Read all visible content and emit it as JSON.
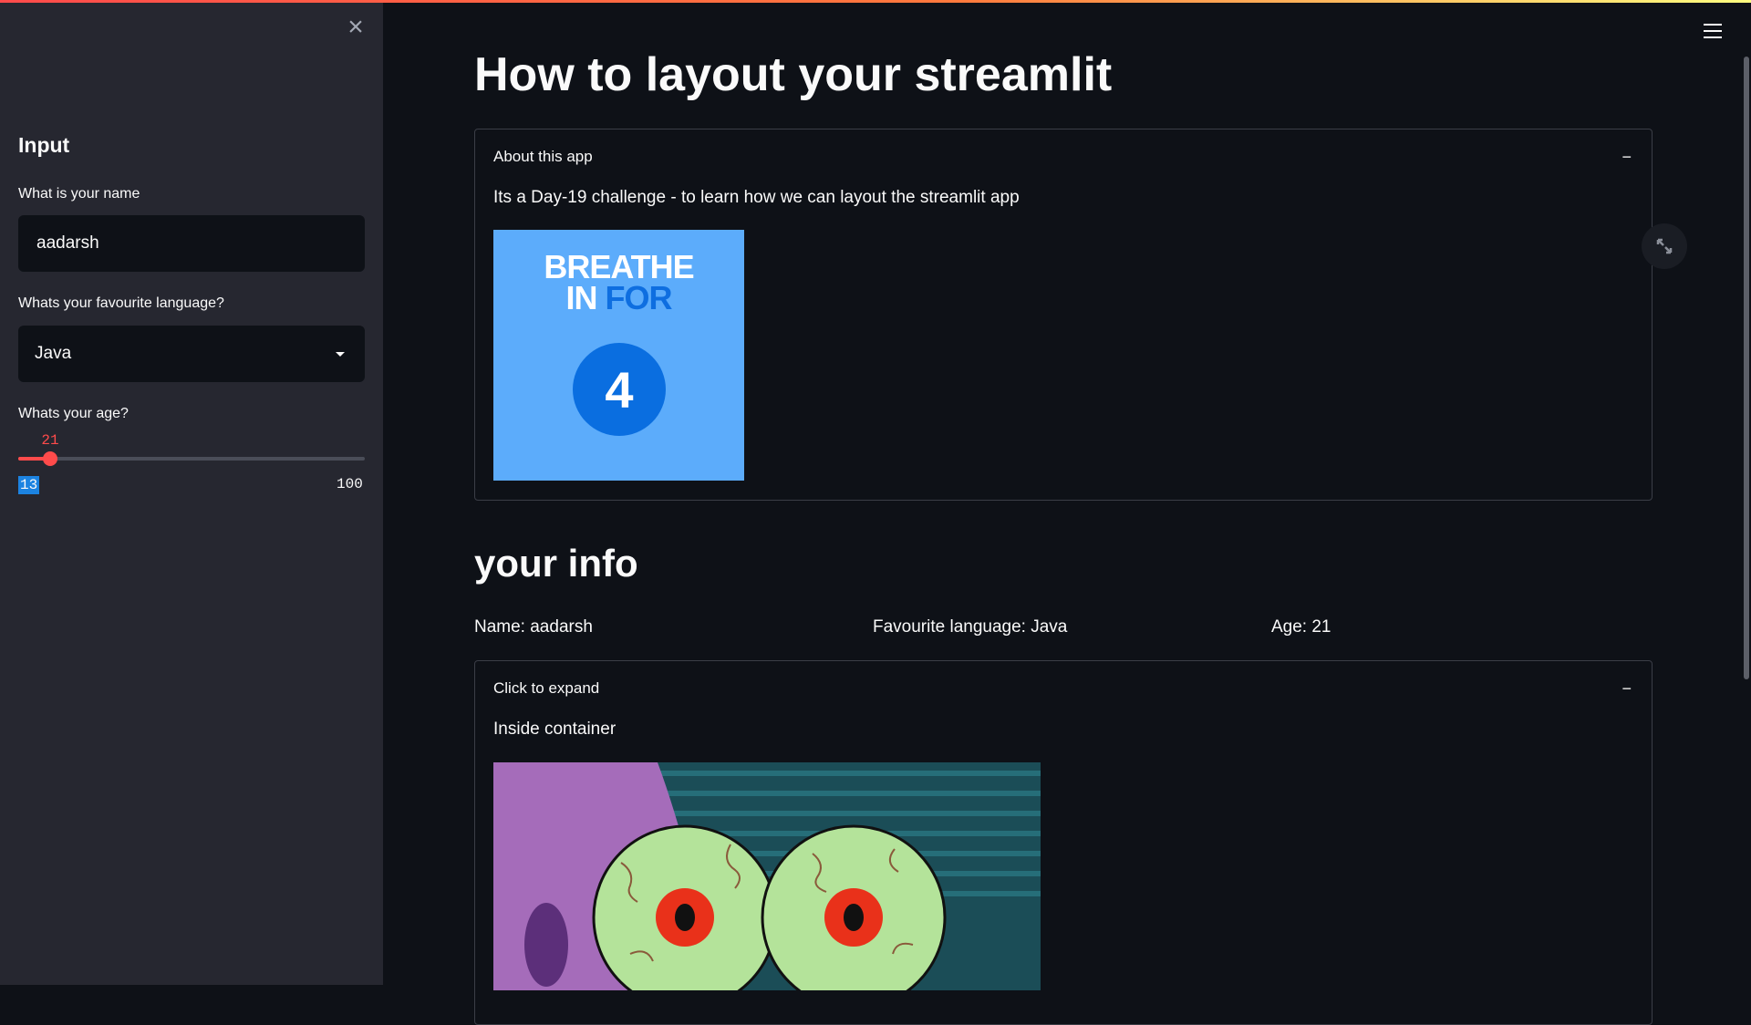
{
  "sidebar": {
    "title": "Input",
    "name_label": "What is your name",
    "name_value": "aadarsh",
    "language_label": "Whats your favourite language?",
    "language_selected": "Java",
    "age_label": "Whats your age?",
    "age_slider": {
      "value": "21",
      "min": "13",
      "max": "100",
      "fraction": 0.092
    },
    "close_icon": "close-icon"
  },
  "main": {
    "title": "How to layout your streamlit",
    "about_expander": {
      "header": "About this app",
      "toggle": "−",
      "text": "Its a Day-19 challenge - to learn how we can layout the streamlit app",
      "image": {
        "line1": "BREATHE",
        "line2_white": "IN ",
        "line2_blue": "FOR",
        "number": "4"
      }
    },
    "info_section": {
      "title": "your info",
      "name": "Name: aadarsh",
      "language": "Favourite language: Java",
      "age": "Age: 21"
    },
    "container_expander": {
      "header": "Click to expand",
      "toggle": "−",
      "text": "Inside container"
    }
  },
  "colors": {
    "accent": "#ff4b4b",
    "background": "#0e1117",
    "sidebar": "#262730",
    "selection": "#1c83e1"
  }
}
